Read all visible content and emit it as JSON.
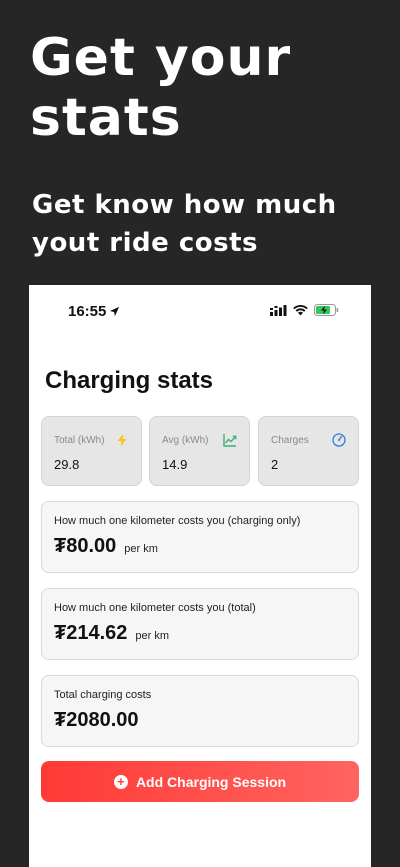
{
  "promo": {
    "title_line1": "Get your",
    "title_line2": "stats",
    "subtitle_line1": "Get know how much",
    "subtitle_line2": "yout ride costs"
  },
  "status_bar": {
    "time": "16:55",
    "icons": [
      "location-arrow-icon",
      "signal-icon",
      "wifi-icon",
      "battery-charging-icon"
    ]
  },
  "page": {
    "title": "Charging stats"
  },
  "stats": [
    {
      "label": "Total (kWh)",
      "value": "29.8",
      "icon": "lightning-icon",
      "icon_color": "#f5c518"
    },
    {
      "label": "Avg (kWh)",
      "value": "14.9",
      "icon": "trend-chart-icon",
      "icon_color": "#3cb371"
    },
    {
      "label": "Charges",
      "value": "2",
      "icon": "gauge-icon",
      "icon_color": "#2f7ce0"
    }
  ],
  "costs": [
    {
      "label": "How much one kilometer costs you (charging only)",
      "amount": "₮80.00",
      "unit": "per km"
    },
    {
      "label": "How much one kilometer costs you (total)",
      "amount": "₮214.62",
      "unit": "per km"
    },
    {
      "label": "Total charging costs",
      "amount": "₮2080.00",
      "unit": ""
    }
  ],
  "actions": {
    "add_session_label": "Add Charging Session",
    "add_icon": "plus-circle-icon"
  },
  "colors": {
    "background": "#262626",
    "accent": "#ff4340"
  }
}
